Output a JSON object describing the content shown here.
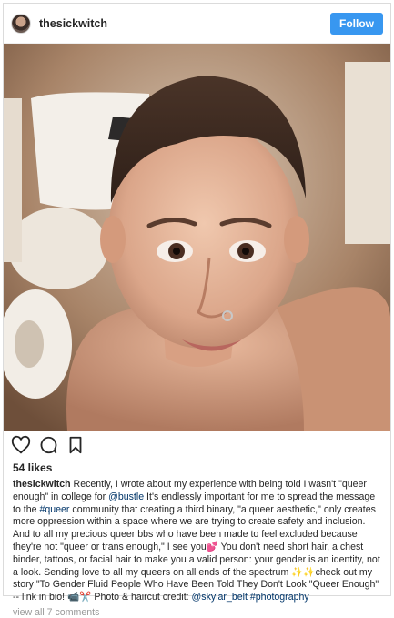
{
  "header": {
    "username": "thesickwitch",
    "follow_label": "Follow"
  },
  "photo": {
    "alt": "Portrait selfie"
  },
  "actions": {
    "like_icon": "heart-icon",
    "comment_icon": "comment-icon",
    "save_icon": "bookmark-icon"
  },
  "likes": "54 likes",
  "caption": {
    "username": "thesickwitch",
    "t1": " Recently, I wrote about my experience with being told I wasn't \"queer enough\" in college for ",
    "mention_bustle": "@bustle",
    "t2": " It's endlessly important for me to spread the message to the ",
    "tag_queer": "#queer",
    "t3": " community that creating a third binary, \"a queer aesthetic,\" only creates more oppression within a space where we are trying to create safety and inclusion. And to all my precious queer bbs who have been made to feel excluded because they're not \"queer or trans enough,\" I see you💕 You don't need short hair, a chest binder, tattoos, or facial hair to make you a valid person: your gender is an identity, not a look. Sending love to all my queers on all ends of the spectrum ✨✨check out my story \"To Gender Fluid People Who Have Been Told They Don't Look \"Queer Enough\" -- link in bio! 📹✂️ Photo & haircut credit: ",
    "mention_skylar": "@skylar_belt",
    "t4": " ",
    "tag_photography": "#photography"
  },
  "view_comments": "view all 7 comments",
  "colors": {
    "follow_bg": "#3897f0",
    "link": "#003569",
    "muted": "#999999"
  }
}
